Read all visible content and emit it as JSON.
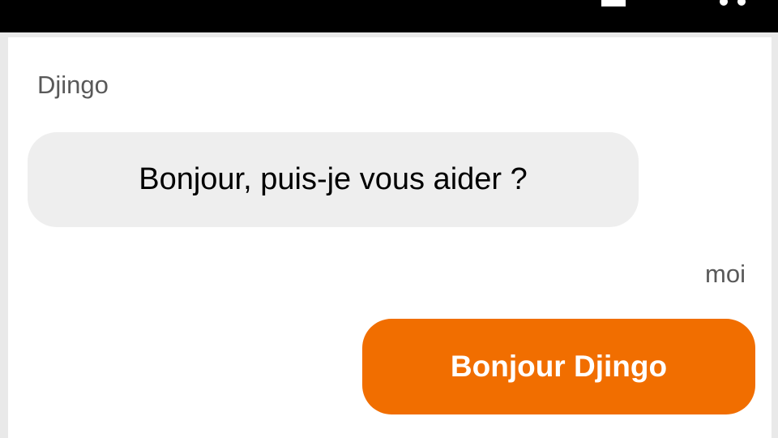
{
  "conversation": {
    "messages": [
      {
        "sender": "Djingo",
        "text": "Bonjour, puis-je vous aider ?"
      },
      {
        "sender": "moi",
        "text": "Bonjour Djingo"
      }
    ]
  },
  "colors": {
    "header_background": "#000000",
    "bot_bubble": "#eeeeee",
    "user_bubble": "#f16e00",
    "sender_label": "#595959"
  },
  "icons": {
    "header_left": "title-fragment",
    "header_right": [
      "minimize-icon",
      "more-icon"
    ]
  }
}
